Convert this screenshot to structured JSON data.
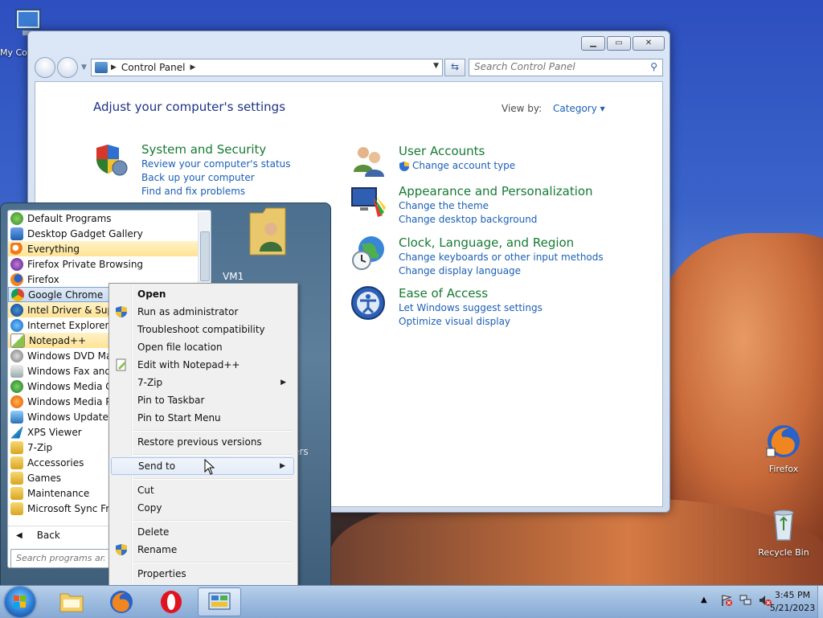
{
  "desktop": {
    "icons": [
      {
        "label": "My Co"
      },
      {
        "label": "Firefox"
      },
      {
        "label": "Recycle Bin"
      }
    ]
  },
  "control_panel": {
    "breadcrumb": "Control Panel",
    "search_placeholder": "Search Control Panel",
    "heading": "Adjust your computer's settings",
    "view_by_label": "View by:",
    "view_by_value": "Category",
    "categories": [
      {
        "title": "System and Security",
        "links": [
          "Review your computer's status",
          "Back up your computer",
          "Find and fix problems"
        ]
      },
      {
        "title": "User Accounts",
        "links": [
          "Change account type"
        ]
      },
      {
        "title": "Appearance and Personalization",
        "links": [
          "Change the theme",
          "Change desktop background"
        ]
      },
      {
        "title": "Clock, Language, and Region",
        "links": [
          "Change keyboards or other input methods",
          "Change display language"
        ]
      },
      {
        "title": "Ease of Access",
        "links": [
          "Let Windows suggest settings",
          "Optimize visual display"
        ]
      }
    ]
  },
  "start_menu": {
    "programs": [
      "Default Programs",
      "Desktop Gadget Gallery",
      "Everything",
      "Firefox Private Browsing",
      "Firefox",
      "Google Chrome",
      "Intel Driver & Suppo",
      "Internet Explorer",
      "Notepad++",
      "Windows DVD Mak",
      "Windows Fax and S",
      "Windows Media Ce",
      "Windows Media Pla",
      "Windows Update",
      "XPS Viewer",
      "7-Zip",
      "Accessories",
      "Games",
      "Maintenance",
      "Microsoft Sync Fran"
    ],
    "back_label": "Back",
    "search_placeholder": "Search programs an",
    "user_name": "VM1",
    "right_fragment": "ers"
  },
  "context_menu": {
    "items": [
      "Open",
      "Run as administrator",
      "Troubleshoot compatibility",
      "Open file location",
      "Edit with Notepad++",
      "7-Zip",
      "Pin to Taskbar",
      "Pin to Start Menu",
      "Restore previous versions",
      "Send to",
      "Cut",
      "Copy",
      "Delete",
      "Rename",
      "Properties"
    ]
  },
  "taskbar": {
    "time": "3:45 PM",
    "date": "5/21/2023"
  },
  "colors": {
    "link_blue": "#1b5fb5",
    "category_green": "#157a33",
    "heading_blue": "#1e3287"
  }
}
